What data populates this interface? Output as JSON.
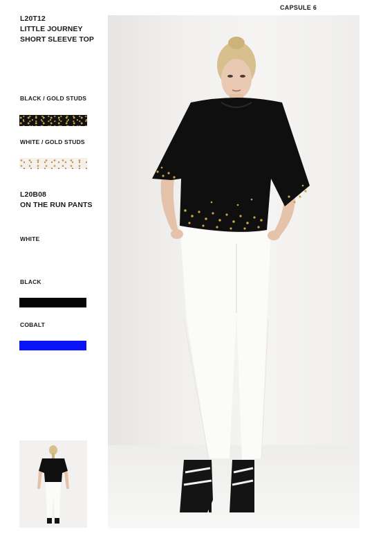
{
  "header": {
    "capsule": "CAPSULE 6"
  },
  "top_style": {
    "code": "L20T12",
    "name_line1": "LITTLE JOURNEY",
    "name_line2": "SHORT SLEEVE TOP"
  },
  "top_colours": [
    {
      "label": "BLACK / GOLD STUDS",
      "swatch_color": "#121212",
      "stud_color": "#c9a24a"
    },
    {
      "label": "WHITE / GOLD STUDS",
      "swatch_color": "#f4f1ec",
      "stud_color": "#c79a4c"
    }
  ],
  "pants_style": {
    "code": "L20B08",
    "name": "ON THE RUN PANTS"
  },
  "pants_colours": [
    {
      "label": "WHITE",
      "swatch_color": "#ffffff"
    },
    {
      "label": "BLACK",
      "swatch_color": "#050505"
    },
    {
      "label": "COBALT",
      "swatch_color": "#0a14f5"
    }
  ]
}
